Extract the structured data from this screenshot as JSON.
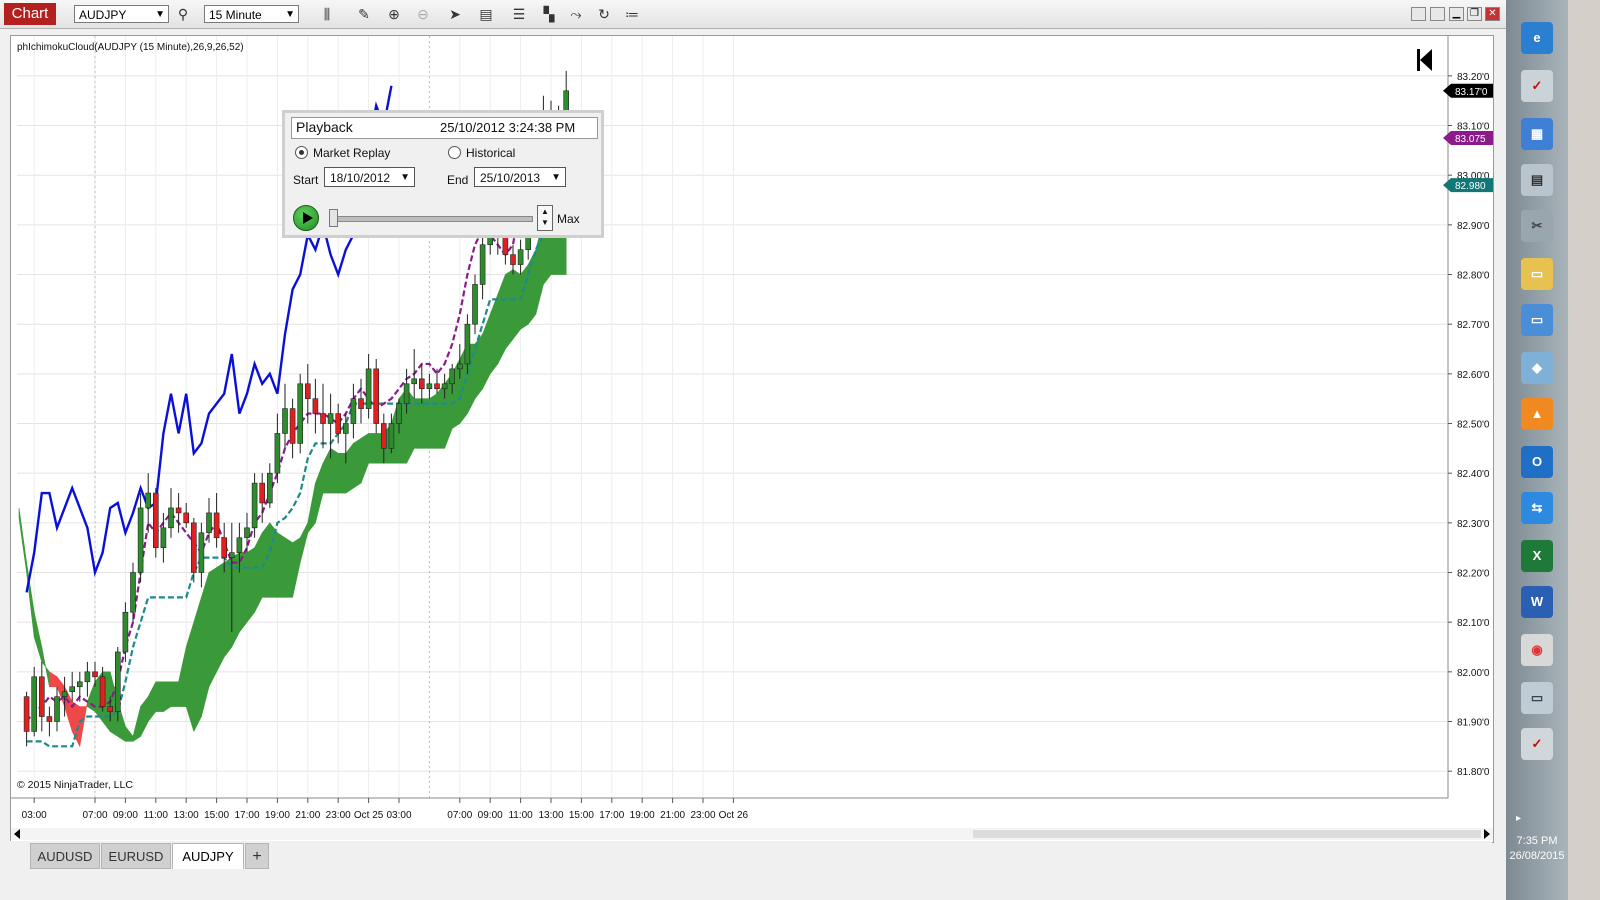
{
  "toolbar": {
    "chart_tab": "Chart",
    "instrument": "AUDJPY",
    "interval": "15 Minute"
  },
  "chart_data": {
    "type": "candlestick",
    "title": "phIchimokuCloud(AUDJPY (15 Minute),26,9,26,52)",
    "copyright": "© 2015 NinjaTrader, LLC",
    "ylim": [
      81.75,
      83.24
    ],
    "yticks": [
      "83.20'0",
      "83.10'0",
      "83.00'0",
      "82.90'0",
      "82.80'0",
      "82.70'0",
      "82.60'0",
      "82.50'0",
      "82.40'0",
      "82.30'0",
      "82.20'0",
      "82.10'0",
      "82.00'0",
      "81.90'0",
      "81.80'0"
    ],
    "ytick_values": [
      83.2,
      83.1,
      83.0,
      82.9,
      82.8,
      82.7,
      82.6,
      82.5,
      82.4,
      82.3,
      82.2,
      82.1,
      82.0,
      81.9,
      81.8
    ],
    "xticks": [
      "03:00",
      "07:00",
      "09:00",
      "11:00",
      "13:00",
      "15:00",
      "17:00",
      "19:00",
      "21:00",
      "23:00",
      "Oct 25",
      "03:00",
      "07:00",
      "09:00",
      "11:00",
      "13:00",
      "15:00",
      "17:00",
      "19:00",
      "21:00",
      "23:00",
      "Oct 26"
    ],
    "xtick_slots": [
      2,
      10,
      14,
      18,
      22,
      26,
      30,
      34,
      38,
      42,
      46,
      50,
      58,
      62,
      66,
      70,
      74,
      78,
      82,
      86,
      90,
      94
    ],
    "price_labels": [
      {
        "text": "83.17'0",
        "value": 83.17,
        "color": "#000000"
      },
      {
        "text": "83.075",
        "value": 83.075,
        "color": "#8b1a8b"
      },
      {
        "text": "82.980",
        "value": 82.98,
        "color": "#117777"
      }
    ],
    "candles": [
      [
        81.95,
        81.96,
        81.85,
        81.88
      ],
      [
        81.88,
        82.01,
        81.87,
        81.99
      ],
      [
        81.99,
        82.02,
        81.88,
        81.91
      ],
      [
        81.91,
        81.93,
        81.87,
        81.9
      ],
      [
        81.9,
        81.97,
        81.88,
        81.95
      ],
      [
        81.95,
        81.99,
        81.91,
        81.96
      ],
      [
        81.96,
        82.0,
        81.94,
        81.97
      ],
      [
        81.97,
        82.0,
        81.94,
        81.98
      ],
      [
        81.98,
        82.02,
        81.95,
        82.0
      ],
      [
        82.0,
        82.02,
        81.97,
        81.99
      ],
      [
        81.99,
        82.01,
        81.92,
        81.93
      ],
      [
        81.93,
        81.95,
        81.9,
        81.92
      ],
      [
        81.92,
        82.05,
        81.9,
        82.04
      ],
      [
        82.04,
        82.14,
        82.02,
        82.12
      ],
      [
        82.12,
        82.22,
        82.1,
        82.2
      ],
      [
        82.2,
        82.36,
        82.18,
        82.33
      ],
      [
        82.33,
        82.4,
        82.28,
        82.36
      ],
      [
        82.36,
        82.37,
        82.23,
        82.25
      ],
      [
        82.25,
        82.32,
        82.22,
        82.29
      ],
      [
        82.29,
        82.37,
        82.27,
        82.33
      ],
      [
        82.33,
        82.36,
        82.28,
        82.32
      ],
      [
        82.32,
        82.34,
        82.29,
        82.3
      ],
      [
        82.3,
        82.31,
        82.18,
        82.2
      ],
      [
        82.2,
        82.3,
        82.17,
        82.28
      ],
      [
        82.28,
        82.35,
        82.26,
        82.32
      ],
      [
        82.32,
        82.36,
        82.25,
        82.27
      ],
      [
        82.27,
        82.3,
        82.2,
        82.23
      ],
      [
        82.23,
        82.3,
        82.08,
        82.24
      ],
      [
        82.24,
        82.3,
        82.2,
        82.27
      ],
      [
        82.27,
        82.32,
        82.24,
        82.29
      ],
      [
        82.29,
        82.4,
        82.27,
        82.38
      ],
      [
        82.38,
        82.4,
        82.3,
        82.34
      ],
      [
        82.34,
        82.42,
        82.33,
        82.4
      ],
      [
        82.4,
        82.52,
        82.38,
        82.48
      ],
      [
        82.48,
        82.58,
        82.45,
        82.53
      ],
      [
        82.53,
        82.55,
        82.43,
        82.46
      ],
      [
        82.46,
        82.6,
        82.44,
        82.58
      ],
      [
        82.58,
        82.62,
        82.5,
        82.55
      ],
      [
        82.55,
        82.59,
        82.48,
        82.52
      ],
      [
        82.52,
        82.58,
        82.45,
        82.5
      ],
      [
        82.5,
        82.56,
        82.43,
        82.52
      ],
      [
        82.52,
        82.54,
        82.46,
        82.48
      ],
      [
        82.48,
        82.52,
        82.42,
        82.5
      ],
      [
        82.5,
        82.58,
        82.47,
        82.55
      ],
      [
        82.55,
        82.59,
        82.5,
        82.53
      ],
      [
        82.53,
        82.64,
        82.51,
        82.61
      ],
      [
        82.61,
        82.63,
        82.48,
        82.5
      ],
      [
        82.5,
        82.52,
        82.42,
        82.45
      ],
      [
        82.45,
        82.52,
        82.44,
        82.5
      ],
      [
        82.5,
        82.55,
        82.48,
        82.54
      ],
      [
        82.54,
        82.61,
        82.52,
        82.58
      ],
      [
        82.58,
        82.65,
        82.55,
        82.59
      ],
      [
        82.59,
        82.62,
        82.54,
        82.57
      ],
      [
        82.57,
        82.6,
        82.55,
        82.58
      ],
      [
        82.58,
        82.61,
        82.56,
        82.57
      ],
      [
        82.57,
        82.6,
        82.55,
        82.58
      ],
      [
        82.58,
        82.62,
        82.56,
        82.61
      ],
      [
        82.61,
        82.66,
        82.59,
        82.62
      ],
      [
        82.62,
        82.72,
        82.6,
        82.7
      ],
      [
        82.7,
        82.8,
        82.68,
        82.78
      ],
      [
        82.78,
        82.88,
        82.75,
        82.86
      ],
      [
        82.86,
        82.96,
        82.84,
        82.92
      ],
      [
        82.92,
        82.94,
        82.84,
        82.88
      ],
      [
        82.88,
        82.9,
        82.82,
        82.84
      ],
      [
        82.84,
        82.86,
        82.8,
        82.82
      ],
      [
        82.82,
        82.87,
        82.8,
        82.85
      ],
      [
        82.85,
        82.98,
        82.83,
        82.96
      ],
      [
        82.96,
        83.1,
        82.94,
        83.08
      ],
      [
        83.08,
        83.16,
        83.04,
        83.12
      ],
      [
        83.12,
        83.15,
        83.06,
        83.1
      ],
      [
        83.1,
        83.14,
        83.05,
        83.08
      ],
      [
        83.08,
        83.21,
        83.06,
        83.17
      ]
    ],
    "series": [
      {
        "name": "Chikou",
        "color": "#0a10d8",
        "values": [
          82.16,
          82.24,
          82.36,
          82.36,
          82.29,
          82.33,
          82.37,
          82.33,
          82.29,
          82.2,
          82.24,
          82.33,
          82.34,
          82.28,
          82.32,
          82.37,
          82.33,
          82.34,
          82.48,
          82.56,
          82.48,
          82.56,
          82.44,
          82.46,
          82.52,
          82.54,
          82.56,
          82.64,
          82.52,
          82.56,
          82.62,
          82.58,
          82.6,
          82.56,
          82.68,
          82.77,
          82.8,
          82.88,
          82.85,
          82.9,
          82.84,
          82.8,
          82.85,
          82.88,
          82.99,
          83.06,
          83.14,
          83.1,
          83.18
        ]
      },
      {
        "name": "Kijun",
        "color": "#1e8a8a",
        "values": [
          81.86,
          81.86,
          81.86,
          81.85,
          81.85,
          81.85,
          81.85,
          81.9,
          81.91,
          81.91,
          81.91,
          81.91,
          81.92,
          81.98,
          82.05,
          82.1,
          82.15,
          82.15,
          82.15,
          82.15,
          82.15,
          82.15,
          82.2,
          82.23,
          82.23,
          82.23,
          82.23,
          82.21,
          82.21,
          82.21,
          82.21,
          82.21,
          82.24,
          82.3,
          82.31,
          82.33,
          82.36,
          82.43,
          82.46,
          82.46,
          82.46,
          82.48,
          82.5,
          82.54,
          82.54,
          82.54,
          82.54,
          82.54,
          82.54,
          82.54,
          82.54,
          82.54,
          82.54,
          82.54,
          82.54,
          82.54,
          82.54,
          82.55,
          82.6,
          82.65,
          82.7,
          82.75,
          82.75,
          82.75,
          82.75,
          82.75,
          82.8,
          82.85,
          82.88,
          82.92,
          82.98
        ]
      },
      {
        "name": "Tenkan",
        "color": "#8b1a8b",
        "values": [
          81.9,
          81.92,
          81.93,
          81.95,
          81.94,
          81.95,
          81.93,
          81.95,
          81.94,
          81.93,
          81.93,
          81.94,
          81.98,
          82.05,
          82.1,
          82.2,
          82.3,
          82.28,
          82.3,
          82.32,
          82.3,
          82.28,
          82.26,
          82.24,
          82.28,
          82.3,
          82.26,
          82.22,
          82.22,
          82.25,
          82.3,
          82.32,
          82.36,
          82.4,
          82.45,
          82.48,
          82.5,
          82.52,
          82.52,
          82.52,
          82.51,
          82.5,
          82.52,
          82.55,
          82.57,
          82.55,
          82.53,
          82.54,
          82.55,
          82.57,
          82.59,
          82.6,
          82.62,
          82.62,
          82.6,
          82.62,
          82.66,
          82.72,
          82.8,
          82.86,
          82.89,
          82.88,
          82.86,
          82.84,
          82.86,
          82.95,
          83.0,
          83.02,
          83.07,
          83.08
        ]
      },
      {
        "name": "SpanA",
        "color": "#3a9a3a",
        "values": [
          82.33,
          82.22,
          82.12,
          82.05,
          81.97,
          81.97,
          81.93,
          81.88,
          81.85,
          81.94,
          81.98,
          82.0,
          82.0,
          81.94,
          81.89,
          81.87,
          81.93,
          81.95,
          81.98,
          81.98,
          81.98,
          81.98,
          82.05,
          82.1,
          82.15,
          82.2,
          82.21,
          82.22,
          82.23,
          82.24,
          82.24,
          82.25,
          82.28,
          82.3,
          82.28,
          82.27,
          82.26,
          82.27,
          82.3,
          82.38,
          82.42,
          82.45,
          82.44,
          82.44,
          82.46,
          82.47,
          82.48,
          82.48,
          82.48,
          82.5,
          82.55,
          82.57,
          82.55,
          82.55,
          82.55,
          82.56,
          82.58,
          82.6,
          82.63,
          82.66,
          82.66,
          82.68,
          82.72,
          82.76,
          82.8,
          82.81,
          82.8,
          82.82,
          82.85,
          82.91,
          82.93,
          82.96,
          83.0
        ]
      },
      {
        "name": "SpanB",
        "color": "#e84040",
        "values": [
          82.31,
          82.2,
          82.07,
          82.02,
          82.0,
          81.99,
          81.97,
          81.94,
          81.93,
          81.93,
          81.92,
          81.9,
          81.88,
          81.87,
          81.86,
          81.86,
          81.87,
          81.9,
          81.92,
          81.92,
          81.93,
          81.93,
          81.93,
          81.88,
          81.91,
          81.97,
          82.0,
          82.03,
          82.05,
          82.08,
          82.1,
          82.12,
          82.15,
          82.15,
          82.15,
          82.15,
          82.15,
          82.22,
          82.28,
          82.3,
          82.36,
          82.36,
          82.36,
          82.36,
          82.37,
          82.38,
          82.42,
          82.42,
          82.42,
          82.42,
          82.42,
          82.42,
          82.45,
          82.45,
          82.45,
          82.45,
          82.45,
          82.49,
          82.5,
          82.52,
          82.55,
          82.57,
          82.6,
          82.62,
          82.65,
          82.67,
          82.69,
          82.7,
          82.72,
          82.78,
          82.8,
          82.8,
          82.8
        ]
      }
    ]
  },
  "playback": {
    "title": "Playback",
    "time": "25/10/2012 3:24:38 PM",
    "market_replay": "Market Replay",
    "historical": "Historical",
    "start_label": "Start",
    "start": "18/10/2012",
    "end_label": "End",
    "end": "25/10/2013",
    "max": "Max"
  },
  "tabs": [
    "AUDUSD",
    "EURUSD",
    "AUDJPY"
  ],
  "add_tab": "+",
  "taskbar": {
    "time": "7:35 PM",
    "date": "26/08/2015"
  }
}
